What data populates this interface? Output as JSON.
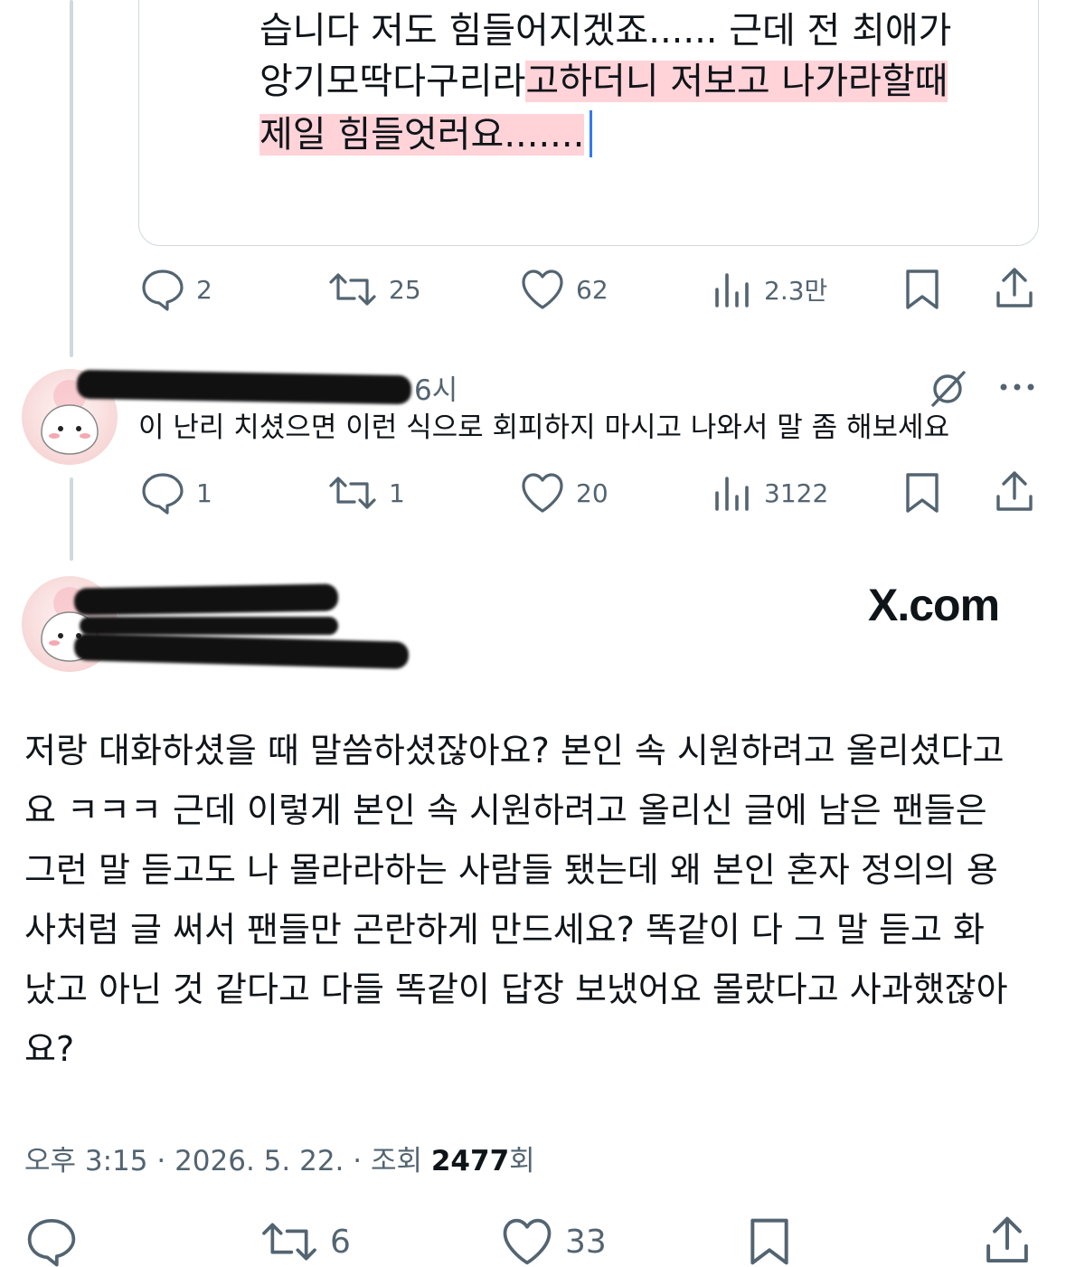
{
  "quoted_tweet": {
    "lines": [
      {
        "plain": "습니다 저도 힘들어지겠죠...... 근데 전 최애가",
        "highlight": ""
      },
      {
        "plain": "앙기모딱다구리라",
        "highlight": "고하더니 저보고 나가라할때"
      },
      {
        "plain": "",
        "highlight": "제일 힘들엇러요......."
      }
    ]
  },
  "tweet1_actions": {
    "replies": "2",
    "retweets": "25",
    "likes": "62",
    "views": "2.3만"
  },
  "reply_tweet": {
    "time": "6시",
    "text": "이 난리 치셨으면 이런 식으로 회피하지 마시고 나와서 말 좀 해보세요",
    "actions": {
      "replies": "1",
      "retweets": "1",
      "likes": "20",
      "views": "3122"
    }
  },
  "main_tweet": {
    "source_label": "X.com",
    "lines": [
      "저랑 대화하셨을 때 말씀하셨잖아요? 본인 속 시원하려고 올리셨다고",
      "요 ㅋㅋㅋ 근데 이렇게 본인 속 시원하려고 올리신 글에 남은 팬들은",
      "그런 말 듣고도 나 몰라라하는 사람들 됐는데 왜 본인 혼자 정의의 용",
      "사처럼 글 써서 팬들만 곤란하게 만드세요? 똑같이 다 그 말 듣고 화",
      "났고 아닌 것 같다고 다들 똑같이 답장 보냈어요 몰랐다고 사과했잖아",
      "요?"
    ],
    "meta_prefix": "오후 3:15 · 2026. 5. 22. · 조회 ",
    "views_count": "2477",
    "views_suffix": "회",
    "actions": {
      "retweets": "6",
      "likes": "33"
    }
  },
  "icons": [
    "reply-icon",
    "retweet-icon",
    "like-icon",
    "views-icon",
    "bookmark-icon",
    "share-icon",
    "grok-icon",
    "more-icon"
  ],
  "colors": {
    "highlight": "#ffd3d8",
    "icon_gray": "#536471",
    "border": "#cfd9de",
    "caret": "#3478f6"
  }
}
